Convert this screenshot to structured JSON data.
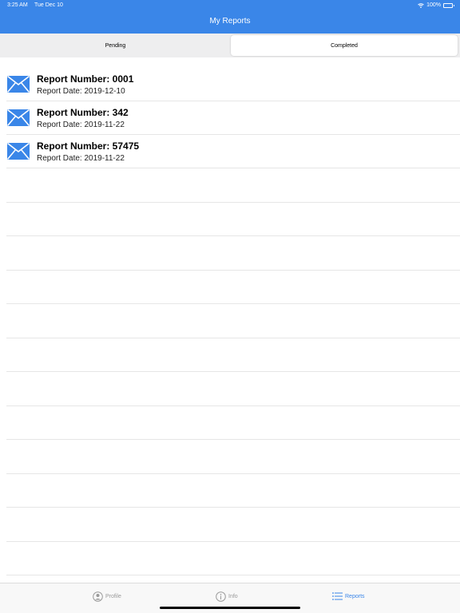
{
  "status_bar": {
    "time": "3:25 AM",
    "date": "Tue Dec 10",
    "battery": "100%"
  },
  "header": {
    "title": "My Reports"
  },
  "segments": {
    "pending": "Pending",
    "completed": "Completed",
    "selected": "Completed"
  },
  "reports": [
    {
      "number": "Report Number: 0001",
      "date": "Report Date: 2019-12-10",
      "icon": "envelope-icon"
    },
    {
      "number": "Report Number: 342",
      "date": "Report Date: 2019-11-22",
      "icon": "envelope-icon"
    },
    {
      "number": "Report Number: 57475",
      "date": "Report Date: 2019-11-22",
      "icon": "envelope-icon"
    }
  ],
  "tabbar": {
    "profile": "Profile",
    "info": "Info",
    "reports": "Reports",
    "active": "Reports"
  },
  "colors": {
    "accent": "#3a86e8"
  }
}
